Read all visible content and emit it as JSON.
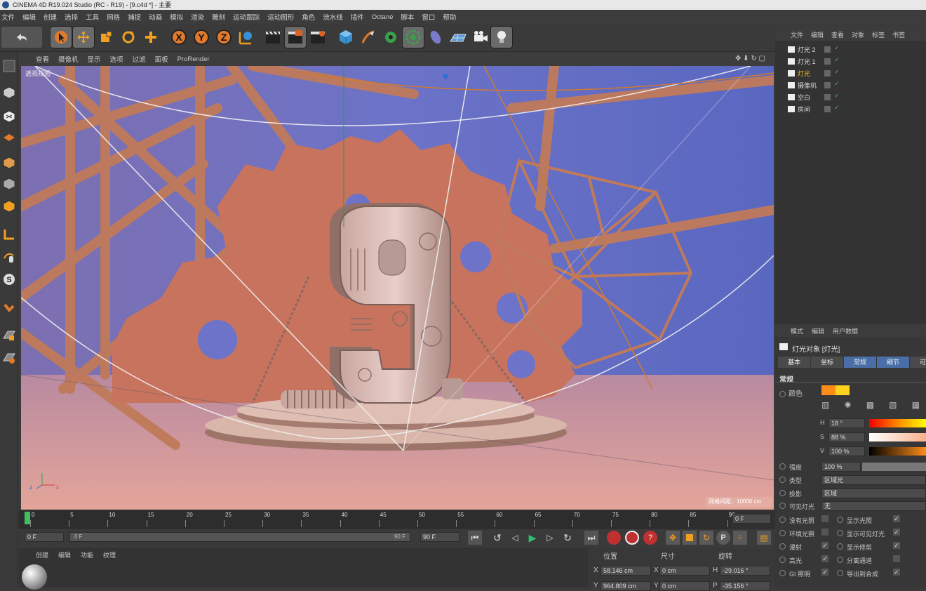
{
  "window": {
    "title": "CINEMA 4D R19.024 Studio (RC - R19) - [9.c4d *] - 主要"
  },
  "menu": [
    "文件",
    "编辑",
    "创建",
    "选择",
    "工具",
    "网格",
    "捕捉",
    "动画",
    "模拟",
    "渲染",
    "雕刻",
    "运动跟踪",
    "运动图形",
    "角色",
    "流水线",
    "插件",
    "Octane",
    "脚本",
    "窗口",
    "帮助"
  ],
  "toolbar": {
    "icons": [
      "undo-icon",
      "live-select-icon",
      "move-icon",
      "scale-icon",
      "rotate-icon",
      "add-icon",
      "x-axis-icon",
      "y-axis-icon",
      "z-axis-icon",
      "world-coordinates-icon",
      "render-view-icon",
      "render-picture-viewer-icon",
      "render-settings-icon",
      "cube-icon",
      "pen-icon",
      "subdivision-icon",
      "array-icon",
      "deformer-icon",
      "floor-icon",
      "camera-icon",
      "light-icon"
    ]
  },
  "viewport": {
    "menu": [
      "查看",
      "摄像机",
      "显示",
      "选项",
      "过滤",
      "面板",
      "ProRender"
    ],
    "label": "透视视图",
    "grid_info": "网格间距：10000 cm"
  },
  "timeline": {
    "ticks": [
      "0",
      "5",
      "10",
      "15",
      "20",
      "25",
      "30",
      "35",
      "40",
      "45",
      "50",
      "55",
      "60",
      "65",
      "70",
      "75",
      "80",
      "85",
      "90"
    ],
    "end_frame": "0 F"
  },
  "playback": {
    "current": "0 F",
    "start": "0 F",
    "range_end": "90 F",
    "end": "90 F"
  },
  "material_manager": {
    "menu": [
      "创建",
      "编辑",
      "功能",
      "纹理"
    ]
  },
  "coordinates": {
    "headers": [
      "位置",
      "尺寸",
      "旋转"
    ],
    "rows": [
      {
        "axis": "X",
        "pos": "58.146 cm",
        "size_axis": "X",
        "size": "0 cm",
        "rot_axis": "H",
        "rot": "-29.016 °"
      },
      {
        "axis": "Y",
        "pos": "964.809 cm",
        "size_axis": "Y",
        "size": "0 cm",
        "rot_axis": "P",
        "rot": "-35.156 °"
      }
    ]
  },
  "object_manager": {
    "menu": [
      "文件",
      "编辑",
      "查看",
      "对象",
      "标签",
      "书签"
    ],
    "objects": [
      {
        "name": "灯光 2",
        "highlight": false
      },
      {
        "name": "灯光 1",
        "highlight": false
      },
      {
        "name": "灯光",
        "highlight": true
      },
      {
        "name": "摄像机",
        "highlight": false
      },
      {
        "name": "空白",
        "highlight": false
      },
      {
        "name": "房间",
        "highlight": false
      }
    ]
  },
  "attributes": {
    "menu": [
      "模式",
      "编辑",
      "用户数据"
    ],
    "object_title": "灯光对象 [灯光]",
    "tabs": [
      "基本",
      "坐标",
      "常规",
      "细节",
      "可见"
    ],
    "active_tabs": [
      "常规",
      "细节"
    ],
    "section": "常规",
    "color_label": "颜色",
    "color_hex": "#ff8c19",
    "hsv": [
      {
        "label": "H",
        "value": "18 °"
      },
      {
        "label": "S",
        "value": "88 %"
      },
      {
        "label": "V",
        "value": "100 %"
      }
    ],
    "intensity_label": "强度",
    "intensity_value": "100 %",
    "type_label": "类型",
    "type_value": "区域光",
    "shadow_label": "投影",
    "shadow_value": "区域",
    "visible_light_label": "可见灯光",
    "visible_light_value": "无",
    "options_left": [
      {
        "label": "没有光照",
        "checked": false
      },
      {
        "label": "环境光照",
        "checked": false
      },
      {
        "label": "漫射",
        "checked": true
      },
      {
        "label": "高光",
        "checked": true
      },
      {
        "label": "GI 照明",
        "checked": true
      }
    ],
    "options_right": [
      {
        "label": "显示光照",
        "checked": true
      },
      {
        "label": "显示可见灯光",
        "checked": true
      },
      {
        "label": "显示修剪",
        "checked": true
      },
      {
        "label": "分离通道",
        "checked": false
      },
      {
        "label": "导出到合成",
        "checked": true
      }
    ]
  }
}
